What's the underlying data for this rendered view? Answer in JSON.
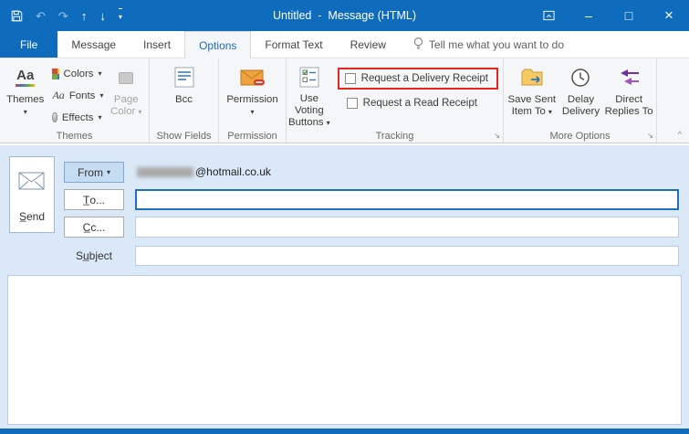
{
  "colors": {
    "titlebar": "#0F6CBD",
    "accent": "#1A6DBE",
    "ribbon_bg": "#F5F6F7",
    "compose_bg": "#DBE8F7",
    "annotation": "#E8251F",
    "group_label": "#696969",
    "disabled": "#A6A6A6"
  },
  "icons": {
    "undo": "↶",
    "redo": "↷",
    "previous": "↑",
    "next": "↓",
    "dropdown": "▾",
    "minimize": "–",
    "maximize": "□",
    "close": "×",
    "launcher": "↘",
    "collapse": "^",
    "themes_glyph": "Aa",
    "fonts_glyph": "Aa"
  },
  "titlebar": {
    "title": "Untitled  -  Message (HTML)"
  },
  "tabs": [
    "File",
    "Message",
    "Insert",
    "Options",
    "Format Text",
    "Review",
    "Tell me what you want to do"
  ],
  "ribbon": {
    "groups": [
      "Themes",
      "Show Fields",
      "Permission",
      "Tracking",
      "More Options"
    ],
    "themes_button": "Themes",
    "colors_button": "Colors",
    "fonts_button": "Fonts",
    "effects_button": "Effects",
    "page_color_1": "Page",
    "page_color_2": "Color",
    "bcc_button": "Bcc",
    "permission_button": "Permission",
    "voting_1": "Use Voting",
    "voting_2": "Buttons",
    "delivery_receipt": "Request a Delivery Receipt",
    "read_receipt": "Request a Read Receipt",
    "save_sent_1": "Save Sent",
    "save_sent_2": "Item To",
    "delay_1": "Delay",
    "delay_2": "Delivery",
    "direct_1": "Direct",
    "direct_2": "Replies To"
  },
  "compose": {
    "send": "S̲end",
    "from": "From",
    "from_value": "@hotmail.co.uk",
    "to": "T̲o...",
    "cc": "C̲c...",
    "subject": "Su̲bject",
    "to_value": "",
    "cc_value": "",
    "subject_value": "",
    "body_text": ""
  }
}
